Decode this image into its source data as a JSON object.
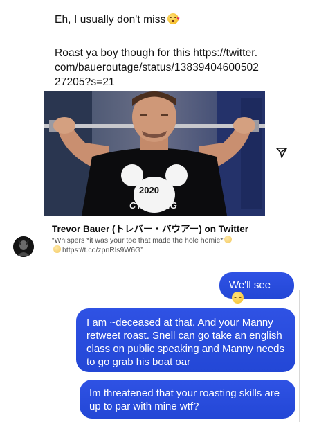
{
  "received": {
    "message_1": "Eh, I usually don't miss",
    "message_1_emoji": "kiss-wink-emoji",
    "message_2": "Roast ya boy though for this https://twitter.com/baueroutage/status/1383940460050227205?s=21"
  },
  "tweet_card": {
    "title": "Trevor Bauer (トレバー・バウアー) on Twitter",
    "description_part1": "“Whispers *it was your toe that made the hole homie*",
    "description_part2": "https://t.co/zpnRls9W6G”",
    "image_caption": "2020 CY YOUNG",
    "image_caption_top": "2020",
    "image_caption_bottom": "CY YOUNG"
  },
  "sent": {
    "bubble_1": "We'll see",
    "bubble_1_emoji": "relieved-face-emoji",
    "bubble_2": "I am ~deceased at that. And your Manny retweet roast. Snell can go take an english class on public speaking and Manny needs to go grab his boat oar",
    "bubble_3": "Im threatened that your roasting skills are up to par with mine wtf?"
  },
  "colors": {
    "sent_bubble": "#2b4ee0",
    "sent_text": "#ffffff",
    "received_text": "#121212"
  },
  "icons": [
    "share-icon",
    "avatar"
  ]
}
